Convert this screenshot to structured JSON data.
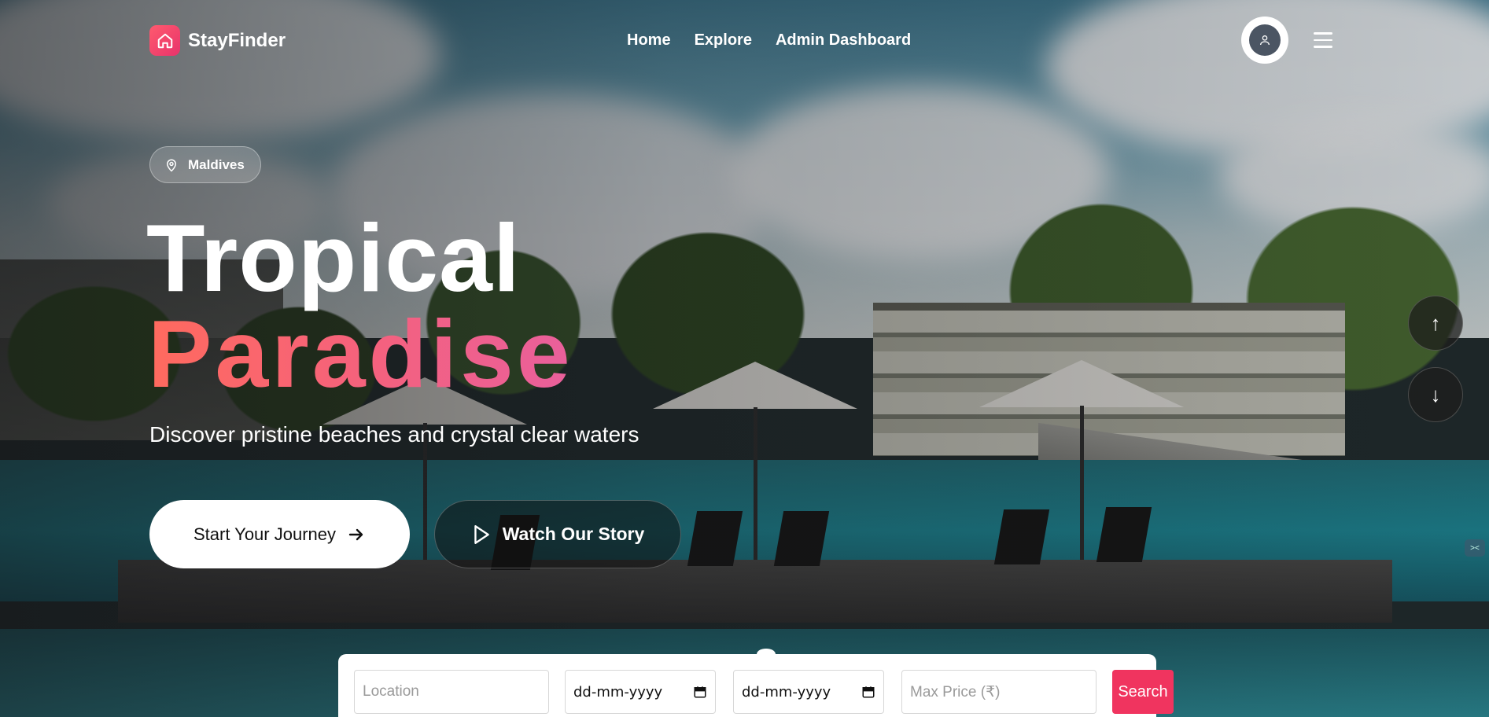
{
  "brand": {
    "name": "StayFinder"
  },
  "nav": {
    "links": [
      {
        "label": "Home"
      },
      {
        "label": "Explore"
      },
      {
        "label": "Admin Dashboard"
      }
    ]
  },
  "hero": {
    "location": "Maldives",
    "title_line1": "Tropical",
    "title_line2": "Paradise",
    "subtitle": "Discover pristine beaches and crystal clear waters",
    "primary_button": "Start Your Journey",
    "secondary_button": "Watch Our Story",
    "scroll_up": "↑",
    "scroll_down": "↓"
  },
  "search": {
    "location_placeholder": "Location",
    "checkin_value": "dd-mm-yyyy",
    "checkout_value": "dd-mm-yyyy",
    "price_placeholder": "Max Price (₹)",
    "button_label": "Search"
  },
  "colors": {
    "accent": "#f0345f",
    "brand_gradient_start": "#ff5a6e",
    "brand_gradient_end": "#e8336b",
    "title_gradient": [
      "#ff6a5e",
      "#e9609c"
    ]
  },
  "icons": {
    "brand": "home-icon",
    "user": "user-icon",
    "menu": "hamburger-menu-icon",
    "location": "map-pin-icon",
    "arrow": "arrow-right-icon",
    "play": "play-icon",
    "calendar": "calendar-icon"
  }
}
